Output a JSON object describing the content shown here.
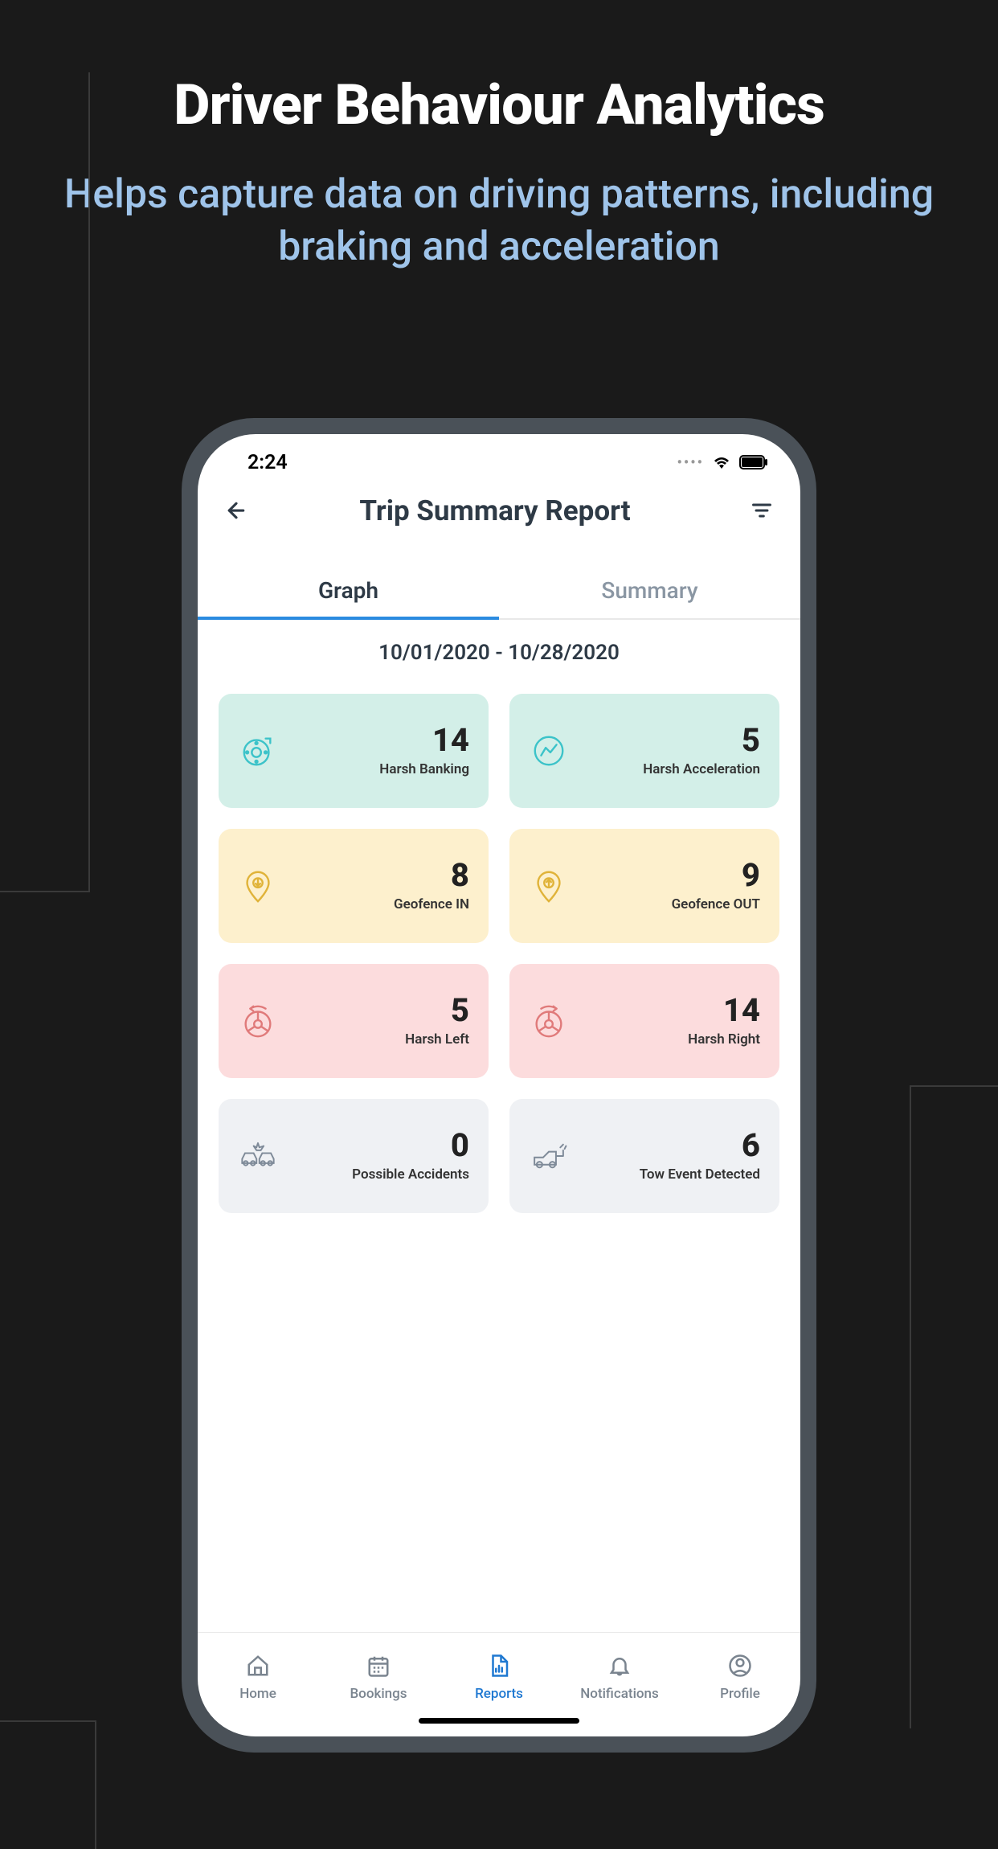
{
  "promo": {
    "title": "Driver Behaviour Analytics",
    "subtitle": "Helps capture data on driving patterns, including braking and acceleration"
  },
  "status": {
    "time": "2:24"
  },
  "header": {
    "title": "Trip Summary Report"
  },
  "tabs": {
    "graph": "Graph",
    "summary": "Summary"
  },
  "date_range": "10/01/2020 - 10/28/2020",
  "metrics": [
    {
      "value": "14",
      "label": "Harsh Banking",
      "color": "teal",
      "icon": "brake-disc"
    },
    {
      "value": "5",
      "label": "Harsh Acceleration",
      "color": "teal",
      "icon": "speedometer"
    },
    {
      "value": "8",
      "label": "Geofence IN",
      "color": "yellow",
      "icon": "pin-in"
    },
    {
      "value": "9",
      "label": "Geofence OUT",
      "color": "yellow",
      "icon": "pin-out"
    },
    {
      "value": "5",
      "label": "Harsh Left",
      "color": "pink",
      "icon": "wheel-left"
    },
    {
      "value": "14",
      "label": "Harsh Right",
      "color": "pink",
      "icon": "wheel-right"
    },
    {
      "value": "0",
      "label": "Possible Accidents",
      "color": "grey",
      "icon": "collision"
    },
    {
      "value": "6",
      "label": "Tow Event Detected",
      "color": "grey",
      "icon": "tow-truck"
    }
  ],
  "nav": {
    "home": "Home",
    "bookings": "Bookings",
    "reports": "Reports",
    "notifications": "Notifications",
    "profile": "Profile"
  }
}
